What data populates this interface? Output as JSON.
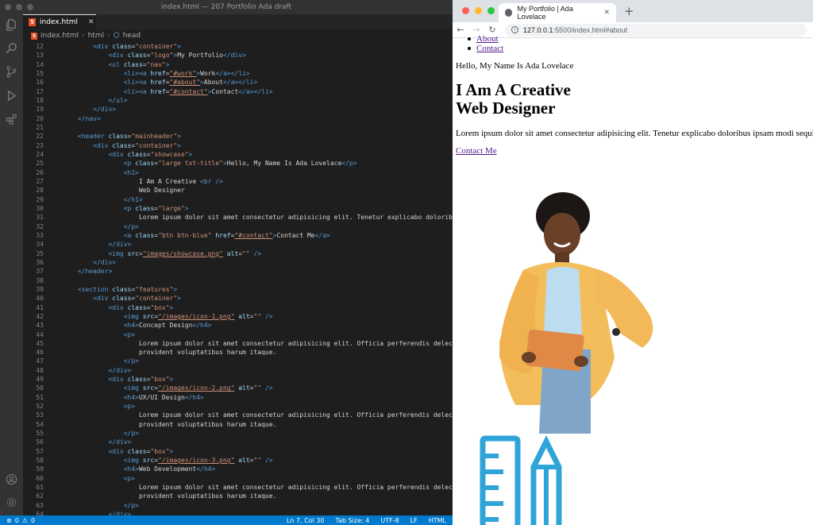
{
  "editor": {
    "window_title": "index.html — 207 Portfolio Ada draft",
    "tab": {
      "label": "index.html",
      "icon": "html5-icon"
    },
    "breadcrumb": [
      "index.html",
      "html",
      "head"
    ],
    "lines": [
      {
        "n": "12",
        "indent": 5,
        "segs": [
          [
            "tag",
            "<div "
          ],
          [
            "attr",
            "class"
          ],
          [
            "txt",
            "="
          ],
          [
            "str",
            "\"container\""
          ],
          [
            "tag",
            ">"
          ]
        ]
      },
      {
        "n": "13",
        "indent": 7,
        "segs": [
          [
            "tag",
            "<div "
          ],
          [
            "attr",
            "class"
          ],
          [
            "txt",
            "="
          ],
          [
            "str",
            "\"logo\""
          ],
          [
            "tag",
            ">"
          ],
          [
            "txt",
            "My Portfolio"
          ],
          [
            "tag",
            "</div>"
          ]
        ]
      },
      {
        "n": "14",
        "indent": 7,
        "segs": [
          [
            "tag",
            "<ul "
          ],
          [
            "attr",
            "class"
          ],
          [
            "txt",
            "="
          ],
          [
            "str",
            "\"nav\""
          ],
          [
            "tag",
            ">"
          ]
        ]
      },
      {
        "n": "15",
        "indent": 9,
        "segs": [
          [
            "tag",
            "<li><a "
          ],
          [
            "attr",
            "href"
          ],
          [
            "txt",
            "="
          ],
          [
            "stru",
            "\"#work\""
          ],
          [
            "tag",
            ">"
          ],
          [
            "txt",
            "Work"
          ],
          [
            "tag",
            "</a></li>"
          ]
        ]
      },
      {
        "n": "16",
        "indent": 9,
        "segs": [
          [
            "tag",
            "<li><a "
          ],
          [
            "attr",
            "href"
          ],
          [
            "txt",
            "="
          ],
          [
            "stru",
            "\"#about\""
          ],
          [
            "tag",
            ">"
          ],
          [
            "txt",
            "About"
          ],
          [
            "tag",
            "</a></li>"
          ]
        ]
      },
      {
        "n": "17",
        "indent": 9,
        "segs": [
          [
            "tag",
            "<li><a "
          ],
          [
            "attr",
            "href"
          ],
          [
            "txt",
            "="
          ],
          [
            "stru",
            "\"#contact\""
          ],
          [
            "tag",
            ">"
          ],
          [
            "txt",
            "Contact"
          ],
          [
            "tag",
            "</a></li>"
          ]
        ]
      },
      {
        "n": "18",
        "indent": 7,
        "segs": [
          [
            "tag",
            "</ul>"
          ]
        ]
      },
      {
        "n": "19",
        "indent": 5,
        "segs": [
          [
            "tag",
            "</div>"
          ]
        ]
      },
      {
        "n": "20",
        "indent": 3,
        "segs": [
          [
            "tag",
            "</nav>"
          ]
        ]
      },
      {
        "n": "21",
        "indent": 0,
        "segs": []
      },
      {
        "n": "22",
        "indent": 3,
        "segs": [
          [
            "tag",
            "<header "
          ],
          [
            "attr",
            "class"
          ],
          [
            "txt",
            "="
          ],
          [
            "str",
            "\"mainheader\""
          ],
          [
            "tag",
            ">"
          ]
        ]
      },
      {
        "n": "23",
        "indent": 5,
        "segs": [
          [
            "tag",
            "<div "
          ],
          [
            "attr",
            "class"
          ],
          [
            "txt",
            "="
          ],
          [
            "str",
            "\"container\""
          ],
          [
            "tag",
            ">"
          ]
        ]
      },
      {
        "n": "24",
        "indent": 7,
        "segs": [
          [
            "tag",
            "<div "
          ],
          [
            "attr",
            "class"
          ],
          [
            "txt",
            "="
          ],
          [
            "str",
            "\"showcase\""
          ],
          [
            "tag",
            ">"
          ]
        ]
      },
      {
        "n": "25",
        "indent": 9,
        "segs": [
          [
            "tag",
            "<p "
          ],
          [
            "attr",
            "class"
          ],
          [
            "txt",
            "="
          ],
          [
            "str",
            "\"large txt-title\""
          ],
          [
            "tag",
            ">"
          ],
          [
            "txt",
            "Hello, My Name Is Ada Lovelace"
          ],
          [
            "tag",
            "</p>"
          ]
        ]
      },
      {
        "n": "26",
        "indent": 9,
        "segs": [
          [
            "tag",
            "<h1>"
          ]
        ]
      },
      {
        "n": "27",
        "indent": 11,
        "segs": [
          [
            "txt",
            "I Am A Creative "
          ],
          [
            "tag",
            "<br />"
          ]
        ]
      },
      {
        "n": "28",
        "indent": 11,
        "segs": [
          [
            "txt",
            "Web Designer"
          ]
        ]
      },
      {
        "n": "29",
        "indent": 9,
        "segs": [
          [
            "tag",
            "</h1>"
          ]
        ]
      },
      {
        "n": "30",
        "indent": 9,
        "segs": [
          [
            "tag",
            "<p "
          ],
          [
            "attr",
            "class"
          ],
          [
            "txt",
            "="
          ],
          [
            "str",
            "\"large\""
          ],
          [
            "tag",
            ">"
          ]
        ]
      },
      {
        "n": "31",
        "indent": 11,
        "segs": [
          [
            "txt",
            "Lorem ipsum dolor sit amet consectetur adipisicing elit. Tenetur explicabo doloribus ipsam modi sequi alias."
          ]
        ]
      },
      {
        "n": "32",
        "indent": 9,
        "segs": [
          [
            "tag",
            "</p>"
          ]
        ]
      },
      {
        "n": "33",
        "indent": 9,
        "segs": [
          [
            "tag",
            "<a "
          ],
          [
            "attr",
            "class"
          ],
          [
            "txt",
            "="
          ],
          [
            "str",
            "\"btn btn-blue\""
          ],
          [
            "attr",
            " href"
          ],
          [
            "txt",
            "="
          ],
          [
            "stru",
            "\"#contact\""
          ],
          [
            "tag",
            ">"
          ],
          [
            "txt",
            "Contact Me"
          ],
          [
            "tag",
            "</a>"
          ]
        ]
      },
      {
        "n": "34",
        "indent": 7,
        "segs": [
          [
            "tag",
            "</div>"
          ]
        ]
      },
      {
        "n": "35",
        "indent": 7,
        "segs": [
          [
            "tag",
            "<img "
          ],
          [
            "attr",
            "src"
          ],
          [
            "txt",
            "="
          ],
          [
            "stru",
            "\"images/showcase.png\""
          ],
          [
            "attr",
            " alt"
          ],
          [
            "txt",
            "="
          ],
          [
            "str",
            "\"\""
          ],
          [
            "tag",
            " />"
          ]
        ]
      },
      {
        "n": "36",
        "indent": 5,
        "segs": [
          [
            "tag",
            "</div>"
          ]
        ]
      },
      {
        "n": "37",
        "indent": 3,
        "segs": [
          [
            "tag",
            "</header>"
          ]
        ]
      },
      {
        "n": "38",
        "indent": 0,
        "segs": []
      },
      {
        "n": "39",
        "indent": 3,
        "segs": [
          [
            "tag",
            "<section "
          ],
          [
            "attr",
            "class"
          ],
          [
            "txt",
            "="
          ],
          [
            "str",
            "\"features\""
          ],
          [
            "tag",
            ">"
          ]
        ]
      },
      {
        "n": "40",
        "indent": 5,
        "segs": [
          [
            "tag",
            "<div "
          ],
          [
            "attr",
            "class"
          ],
          [
            "txt",
            "="
          ],
          [
            "str",
            "\"container\""
          ],
          [
            "tag",
            ">"
          ]
        ]
      },
      {
        "n": "41",
        "indent": 7,
        "segs": [
          [
            "tag",
            "<div "
          ],
          [
            "attr",
            "class"
          ],
          [
            "txt",
            "="
          ],
          [
            "str",
            "\"box\""
          ],
          [
            "tag",
            ">"
          ]
        ]
      },
      {
        "n": "42",
        "indent": 9,
        "segs": [
          [
            "tag",
            "<img "
          ],
          [
            "attr",
            "src"
          ],
          [
            "txt",
            "="
          ],
          [
            "stru",
            "\"/images/icon-1.png\""
          ],
          [
            "attr",
            " alt"
          ],
          [
            "txt",
            "="
          ],
          [
            "str",
            "\"\""
          ],
          [
            "tag",
            " />"
          ]
        ]
      },
      {
        "n": "43",
        "indent": 9,
        "segs": [
          [
            "tag",
            "<h4>"
          ],
          [
            "txt",
            "Concept Design"
          ],
          [
            "tag",
            "</h4>"
          ]
        ]
      },
      {
        "n": "44",
        "indent": 9,
        "segs": [
          [
            "tag",
            "<p>"
          ]
        ]
      },
      {
        "n": "45",
        "indent": 11,
        "segs": [
          [
            "txt",
            "Lorem ipsum dolor sit amet consectetur adipisicing elit. Officia perferendis delectus"
          ]
        ]
      },
      {
        "n": "46",
        "indent": 11,
        "segs": [
          [
            "txt",
            "provident voluptatibus harum itaque."
          ]
        ]
      },
      {
        "n": "47",
        "indent": 9,
        "segs": [
          [
            "tag",
            "</p>"
          ]
        ]
      },
      {
        "n": "48",
        "indent": 7,
        "segs": [
          [
            "tag",
            "</div>"
          ]
        ]
      },
      {
        "n": "49",
        "indent": 7,
        "segs": [
          [
            "tag",
            "<div "
          ],
          [
            "attr",
            "class"
          ],
          [
            "txt",
            "="
          ],
          [
            "str",
            "\"box\""
          ],
          [
            "tag",
            ">"
          ]
        ]
      },
      {
        "n": "50",
        "indent": 9,
        "segs": [
          [
            "tag",
            "<img "
          ],
          [
            "attr",
            "src"
          ],
          [
            "txt",
            "="
          ],
          [
            "stru",
            "\"/images/icon-2.png\""
          ],
          [
            "attr",
            " alt"
          ],
          [
            "txt",
            "="
          ],
          [
            "str",
            "\"\""
          ],
          [
            "tag",
            " />"
          ]
        ]
      },
      {
        "n": "51",
        "indent": 9,
        "segs": [
          [
            "tag",
            "<h4>"
          ],
          [
            "txt",
            "UX/UI Design"
          ],
          [
            "tag",
            "</h4>"
          ]
        ]
      },
      {
        "n": "52",
        "indent": 9,
        "segs": [
          [
            "tag",
            "<p>"
          ]
        ]
      },
      {
        "n": "53",
        "indent": 11,
        "segs": [
          [
            "txt",
            "Lorem ipsum dolor sit amet consectetur adipisicing elit. Officia perferendis delectus"
          ]
        ]
      },
      {
        "n": "54",
        "indent": 11,
        "segs": [
          [
            "txt",
            "provident voluptatibus harum itaque."
          ]
        ]
      },
      {
        "n": "55",
        "indent": 9,
        "segs": [
          [
            "tag",
            "</p>"
          ]
        ]
      },
      {
        "n": "56",
        "indent": 7,
        "segs": [
          [
            "tag",
            "</div>"
          ]
        ]
      },
      {
        "n": "57",
        "indent": 7,
        "segs": [
          [
            "tag",
            "<div "
          ],
          [
            "attr",
            "class"
          ],
          [
            "txt",
            "="
          ],
          [
            "str",
            "\"box\""
          ],
          [
            "tag",
            ">"
          ]
        ]
      },
      {
        "n": "58",
        "indent": 9,
        "segs": [
          [
            "tag",
            "<img "
          ],
          [
            "attr",
            "src"
          ],
          [
            "txt",
            "="
          ],
          [
            "stru",
            "\"/images/icon-3.png\""
          ],
          [
            "attr",
            " alt"
          ],
          [
            "txt",
            "="
          ],
          [
            "str",
            "\"\""
          ],
          [
            "tag",
            " />"
          ]
        ]
      },
      {
        "n": "59",
        "indent": 9,
        "segs": [
          [
            "tag",
            "<h4>"
          ],
          [
            "txt",
            "Web Development"
          ],
          [
            "tag",
            "</h4>"
          ]
        ]
      },
      {
        "n": "60",
        "indent": 9,
        "segs": [
          [
            "tag",
            "<p>"
          ]
        ]
      },
      {
        "n": "61",
        "indent": 11,
        "segs": [
          [
            "txt",
            "Lorem ipsum dolor sit amet consectetur adipisicing elit. Officia perferendis delectus"
          ]
        ]
      },
      {
        "n": "62",
        "indent": 11,
        "segs": [
          [
            "txt",
            "provident voluptatibus harum itaque."
          ]
        ]
      },
      {
        "n": "63",
        "indent": 9,
        "segs": [
          [
            "tag",
            "</p>"
          ]
        ]
      },
      {
        "n": "64",
        "indent": 7,
        "segs": [
          [
            "tag",
            "</div>"
          ]
        ]
      }
    ],
    "status": {
      "errors": "0",
      "warnings": "0",
      "position": "Ln 7, Col 30",
      "tab_size": "Tab Size: 4",
      "encoding": "UTF-8",
      "eol": "LF",
      "language": "HTML"
    },
    "colors": {
      "accent": "#007acc",
      "tag": "#569cd6",
      "attr": "#9cdcfe",
      "string": "#ce9178"
    }
  },
  "browser": {
    "tab_title": "My Portfolio | Ada Lovelace",
    "url_host": "127.0.0.1",
    "url_path": ":5500/index.html#about",
    "page": {
      "nav_links": [
        "About",
        "Contact"
      ],
      "greeting": "Hello, My Name Is Ada Lovelace",
      "heading_line1": "I Am A Creative",
      "heading_line2": "Web Designer",
      "lead": "Lorem ipsum dolor sit amet consectetur adipisicing elit. Tenetur explicabo doloribus ipsam modi sequi alias.",
      "cta": "Contact Me"
    }
  }
}
